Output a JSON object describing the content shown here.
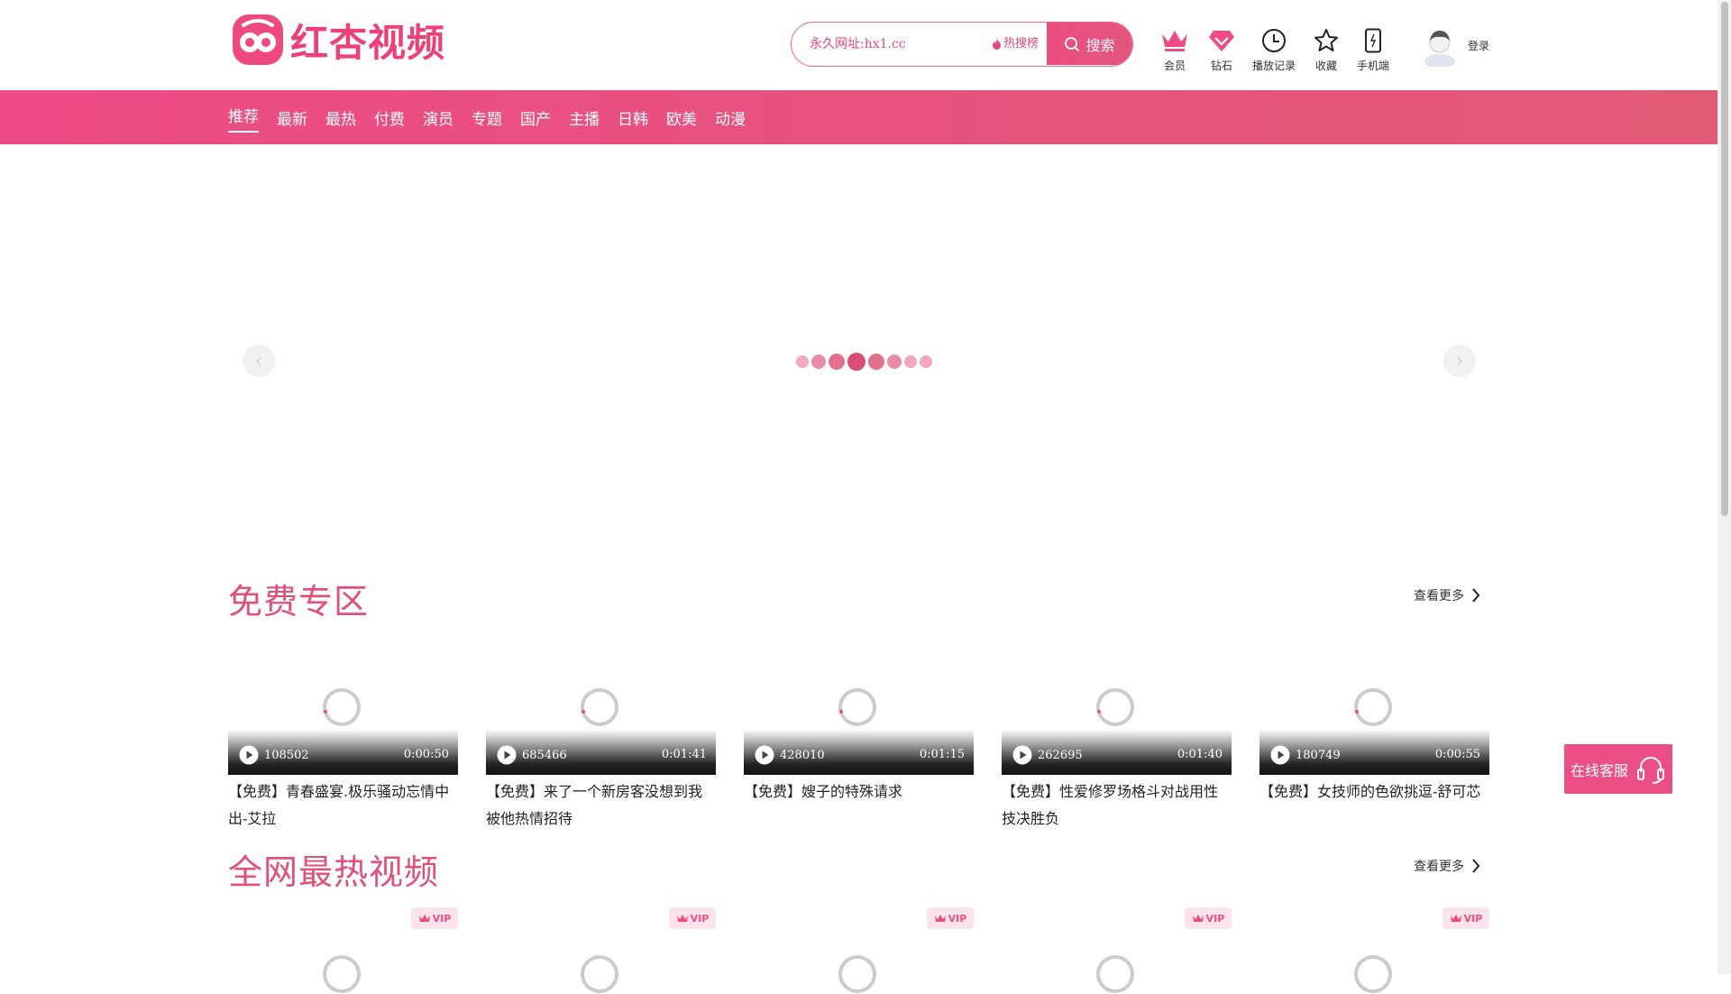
{
  "brand": {
    "name": "红杏视频",
    "color": "#ee3f78"
  },
  "search": {
    "value": "永久网址:hx1.cc",
    "hot_label": "热搜榜",
    "button_label": "搜索"
  },
  "header_icons": [
    {
      "label": "会员",
      "icon": "crown-icon"
    },
    {
      "label": "钻石",
      "icon": "diamond-icon"
    },
    {
      "label": "播放记录",
      "icon": "clock-icon"
    },
    {
      "label": "收藏",
      "icon": "star-icon"
    },
    {
      "label": "手机端",
      "icon": "phone-icon"
    }
  ],
  "user": {
    "login_label": "登录"
  },
  "nav": {
    "items": [
      "推荐",
      "最新",
      "最热",
      "付费",
      "演员",
      "专题",
      "国产",
      "主播",
      "日韩",
      "欧美",
      "动漫"
    ],
    "active_index": 0
  },
  "carousel": {
    "prev_label": "‹",
    "next_label": "›",
    "dot_count": 8,
    "active_dot": 3
  },
  "sections": {
    "free": {
      "title": "免费专区",
      "more_label": "查看更多",
      "videos": [
        {
          "views": "108502",
          "duration": "0:00:50",
          "title": "【免费】青春盛宴.极乐骚动忘情中出-艾拉"
        },
        {
          "views": "685466",
          "duration": "0:01:41",
          "title": "【免费】来了一个新房客没想到我被他热情招待"
        },
        {
          "views": "428010",
          "duration": "0:01:15",
          "title": "【免费】嫂子的特殊请求"
        },
        {
          "views": "262695",
          "duration": "0:01:40",
          "title": "【免费】性爱修罗场格斗对战用性技决胜负"
        },
        {
          "views": "180749",
          "duration": "0:00:55",
          "title": "【免费】女技师的色欲挑逗-舒可芯"
        }
      ]
    },
    "hot": {
      "title": "全网最热视频",
      "more_label": "查看更多",
      "badge": "VIP",
      "card_count": 5
    }
  },
  "service": {
    "label": "在线客服"
  },
  "colors": {
    "accent": "#ec4f86",
    "nav_gradient_start": "#ee4c86",
    "nav_gradient_end": "#e35a78"
  }
}
